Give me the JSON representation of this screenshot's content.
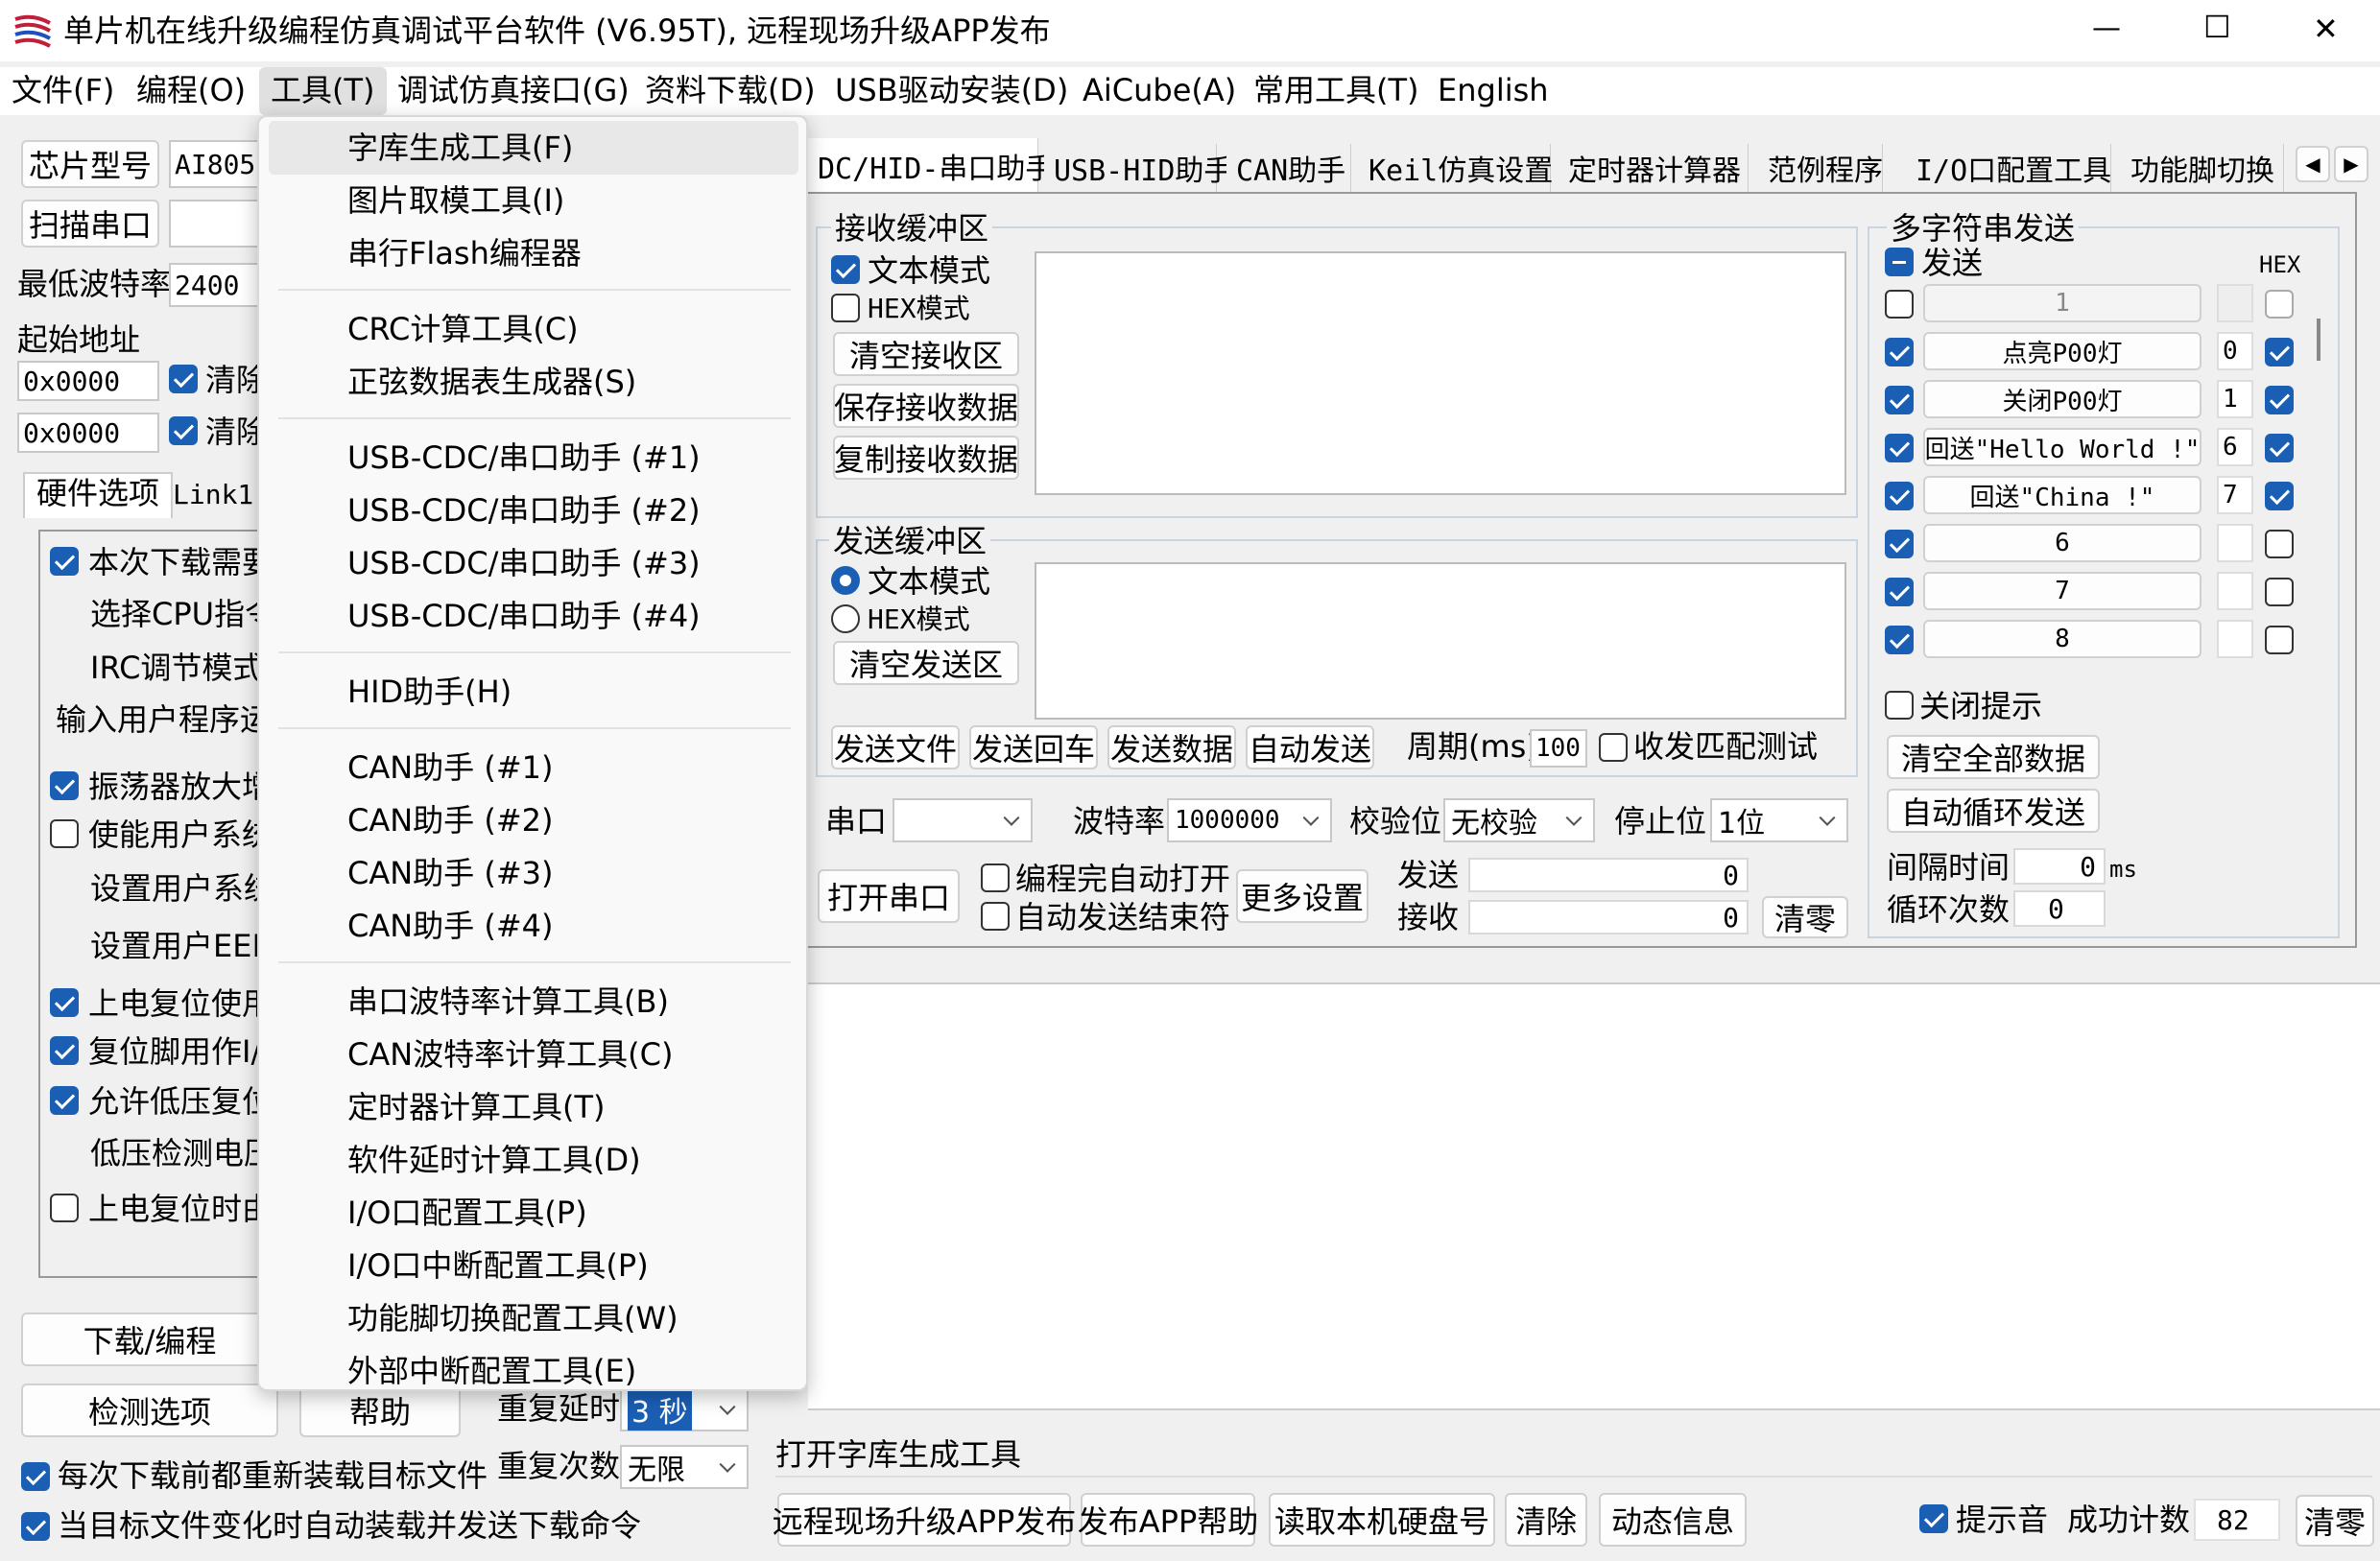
{
  "title": "单片机在线升级编程仿真调试平台软件 (V6.95T), 远程现场升级APP发布",
  "window_controls": {
    "minimize": "—",
    "maximize": "☐",
    "close": "✕"
  },
  "menubar": [
    "文件(F)",
    "编程(O)",
    "工具(T)",
    "调试仿真接口(G)",
    "资料下载(D)",
    "USB驱动安装(D)",
    "AiCube(A)",
    "常用工具(T)",
    "English"
  ],
  "tools_menu": {
    "groups": [
      [
        "字库生成工具(F)",
        "图片取模工具(I)",
        "串行Flash编程器"
      ],
      [
        "CRC计算工具(C)",
        "正弦数据表生成器(S)"
      ],
      [
        "USB-CDC/串口助手 (#1)",
        "USB-CDC/串口助手 (#2)",
        "USB-CDC/串口助手 (#3)",
        "USB-CDC/串口助手 (#4)"
      ],
      [
        "HID助手(H)"
      ],
      [
        "CAN助手 (#1)",
        "CAN助手 (#2)",
        "CAN助手 (#3)",
        "CAN助手 (#4)"
      ],
      [
        "串口波特率计算工具(B)",
        "CAN波特率计算工具(C)",
        "定时器计算工具(T)",
        "软件延时计算工具(D)",
        "I/O口配置工具(P)",
        "I/O口中断配置工具(P)",
        "功能脚切换配置工具(W)",
        "外部中断配置工具(E)"
      ]
    ]
  },
  "left": {
    "chip_btn": "芯片型号",
    "chip_val": "AI805",
    "scan_btn": "扫描串口",
    "min_baud_label": "最低波特率",
    "min_baud": "2400",
    "start_addr_label": "起始地址",
    "addr1": "0x0000",
    "addr2": "0x0000",
    "clear1": "清除",
    "clear2": "清除",
    "tabs": [
      "硬件选项",
      "Link1"
    ],
    "options": [
      {
        "label": "本次下载需要",
        "checked": true,
        "cb": true
      },
      {
        "label": "选择CPU指令",
        "cb": false
      },
      {
        "label": "IRC调节模式",
        "cb": false
      },
      {
        "label": "输入用户程序运",
        "cb": false
      },
      {
        "label": "振荡器放大增",
        "checked": true,
        "cb": true
      },
      {
        "label": "使能用户系统",
        "checked": false,
        "cb": true
      },
      {
        "label": "设置用户系统",
        "cb": false
      },
      {
        "label": "设置用户EEPI",
        "cb": false
      },
      {
        "label": "上电复位使用",
        "checked": true,
        "cb": true
      },
      {
        "label": "复位脚用作I/",
        "checked": true,
        "cb": true
      },
      {
        "label": "允许低压复位",
        "checked": true,
        "cb": true
      },
      {
        "label": "低压检测电压",
        "cb": false
      },
      {
        "label": "上电复位时由",
        "checked": false,
        "cb": true
      }
    ],
    "download_btn": "下载/编程",
    "detect_btn": "检测选项",
    "help_btn": "帮助",
    "retry_delay_label": "重复延时",
    "retry_delay": "3 秒",
    "retry_count_label": "重复次数",
    "retry_count": "无限",
    "reload_before": "每次下载前都重新装载目标文件",
    "auto_reload": "当目标文件变化时自动装载并发送下载命令"
  },
  "tabs": [
    "DC/HID-串口助手",
    "USB-HID助手",
    "CAN助手",
    "Keil仿真设置",
    "定时器计算器",
    "范例程序",
    "I/O口配置工具",
    "功能脚切换"
  ],
  "serial": {
    "recv_title": "接收缓冲区",
    "text_mode": "文本模式",
    "hex_mode": "HEX模式",
    "clear_recv": "清空接收区",
    "save_recv": "保存接收数据",
    "copy_recv": "复制接收数据",
    "send_title": "发送缓冲区",
    "clear_send": "清空发送区",
    "send_file": "发送文件",
    "send_cr": "发送回车",
    "send_data": "发送数据",
    "auto_send": "自动发送",
    "period_label": "周期(ms)",
    "period": "100",
    "match_test": "收发匹配测试",
    "port_label": "串口",
    "port": "",
    "baud_label": "波特率",
    "baud": "1000000",
    "parity_label": "校验位",
    "parity": "无校验",
    "stop_label": "停止位",
    "stop": "1位",
    "open_btn": "打开串口",
    "auto_open": "编程完自动打开",
    "auto_end": "自动发送结束符",
    "more_btn": "更多设置",
    "tx_label": "发送",
    "tx": "0",
    "rx_label": "接收",
    "rx": "0",
    "zero_btn": "清零"
  },
  "multi": {
    "title": "多字符串发送",
    "send_label": "发送",
    "hex_label": "HEX",
    "rows": [
      {
        "cb": false,
        "text": "1",
        "num": "",
        "hex": false
      },
      {
        "cb": true,
        "text": "点亮P00灯",
        "num": "0",
        "hex": true
      },
      {
        "cb": true,
        "text": "关闭P00灯",
        "num": "1",
        "hex": true
      },
      {
        "cb": true,
        "text": "回送\"Hello World !\"",
        "num": "6",
        "hex": true
      },
      {
        "cb": true,
        "text": "回送\"China !\"",
        "num": "7",
        "hex": true
      },
      {
        "cb": true,
        "text": "6",
        "num": "",
        "hex": false
      },
      {
        "cb": true,
        "text": "7",
        "num": "",
        "hex": false
      },
      {
        "cb": true,
        "text": "8",
        "num": "",
        "hex": false
      }
    ],
    "close_tip": "关闭提示",
    "clear_all": "清空全部数据",
    "auto_loop": "自动循环发送",
    "interval_label": "间隔时间",
    "interval": "0",
    "interval_unit": "ms",
    "loop_label": "循环次数",
    "loop": "0"
  },
  "status": "打开字库生成工具",
  "bottom": {
    "publish": "远程现场升级APP发布",
    "help": "发布APP帮助",
    "disk": "读取本机硬盘号",
    "clear": "清除",
    "dynamic": "动态信息",
    "sound": "提示音",
    "success_label": "成功计数",
    "success": "82",
    "zero": "清零"
  }
}
